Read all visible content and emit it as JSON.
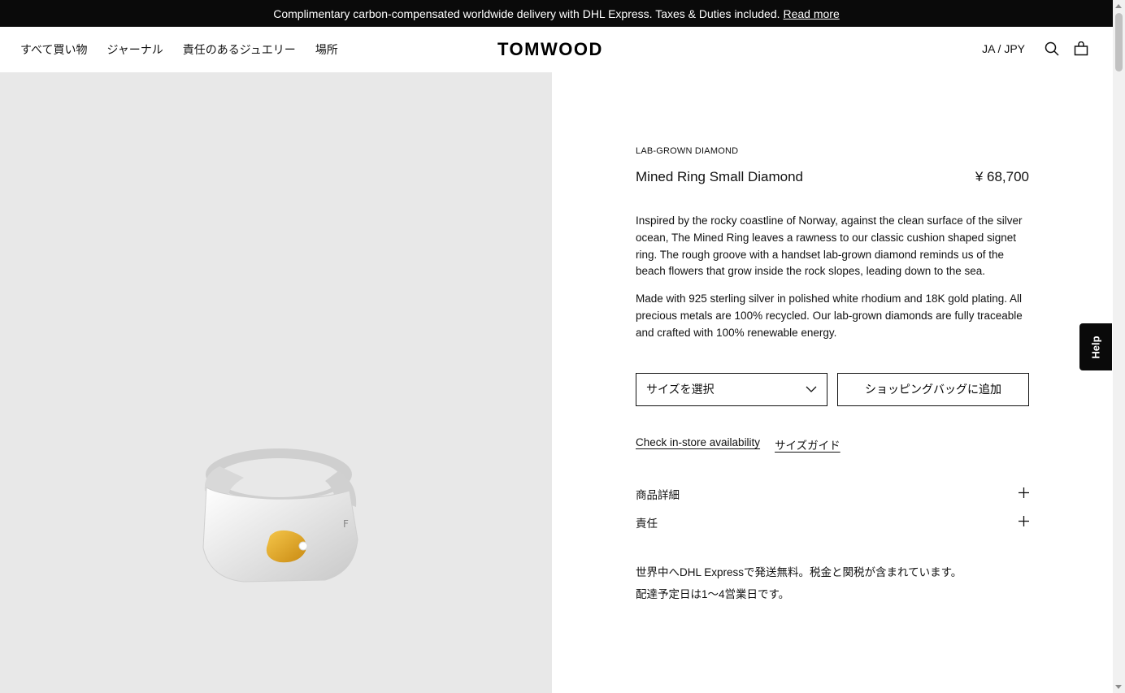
{
  "announcement": {
    "text": "Complimentary carbon-compensated worldwide delivery with DHL Express. Taxes & Duties included.",
    "link": "Read more"
  },
  "header": {
    "nav": [
      "すべて買い物",
      "ジャーナル",
      "責任のあるジュエリー",
      "場所"
    ],
    "logo": "TOMWOOD",
    "locale": "JA / JPY",
    "icons": [
      "search-icon",
      "bag-icon"
    ]
  },
  "product": {
    "eyebrow": "LAB-GROWN DIAMOND",
    "title": "Mined Ring Small Diamond",
    "price": "¥ 68,700",
    "description": [
      "Inspired by the rocky coastline of Norway, against the clean surface of the silver ocean, The Mined Ring leaves a rawness to our classic cushion shaped signet ring. The rough groove with a handset lab-grown diamond reminds us of the beach flowers that grow inside the rock slopes, leading down to the sea.",
      "Made with 925 sterling silver in polished white rhodium and 18K gold plating. All precious metals are 100% recycled. Our lab-grown diamonds are fully traceable and crafted with 100% renewable energy."
    ],
    "size_select": "サイズを選択",
    "add_to_bag": "ショッピングバッグに追加",
    "links": [
      "Check in-store availability",
      "サイズガイド"
    ],
    "accordion": [
      "商品詳細",
      "責任"
    ],
    "shipping": [
      "世界中へDHL Expressで発送無料。税金と関税が含まれています。",
      "配達予定日は1〜4営業日です。"
    ]
  },
  "help_tab": "Help",
  "colors": {
    "announcement_bg": "#0a0a0a",
    "media_bg": "#e8e8e8",
    "text": "#111111"
  }
}
